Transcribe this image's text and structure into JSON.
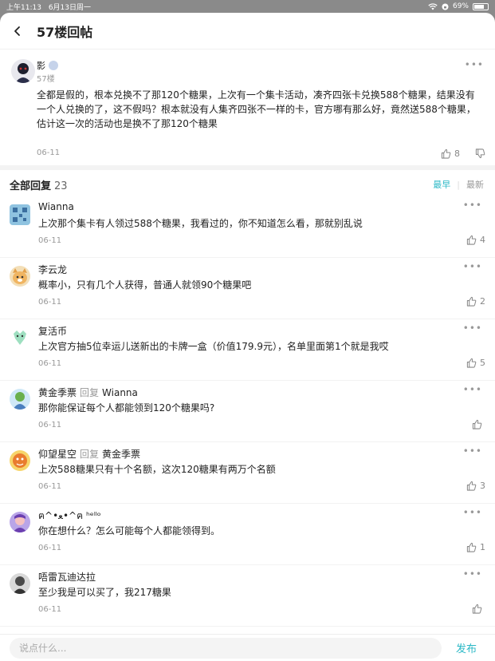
{
  "status_bar": {
    "time": "上午11:13",
    "date": "6月13日周一",
    "battery": "69%"
  },
  "nav": {
    "title": "57楼回帖"
  },
  "main_post": {
    "author": "影",
    "floor": "57楼",
    "content": "全都是假的，根本兑换不了那120个糖果，上次有一个集卡活动，凑齐四张卡兑换588个糖果，结果没有一个人兑换的了，这不假吗？根本就没有人集齐四张不一样的卡，官方哪有那么好，竟然送588个糖果，估计这一次的活动也是换不了那120个糖果",
    "date": "06-11",
    "likes": "8"
  },
  "replies_header": {
    "title": "全部回复",
    "count": "23",
    "sort_earliest": "最早",
    "sort_latest": "最新"
  },
  "replies": [
    {
      "author": "Wianna",
      "reply_label": "",
      "reply_to": "",
      "text": "上次那个集卡有人领过588个糖果，我看过的，你不知道怎么看，那就别乱说",
      "date": "06-11",
      "likes": "4"
    },
    {
      "author": "李云龙",
      "reply_label": "",
      "reply_to": "",
      "text": "概率小，只有几个人获得，普通人就领90个糖果吧",
      "date": "06-11",
      "likes": "2"
    },
    {
      "author": "复活币",
      "reply_label": "",
      "reply_to": "",
      "text": "上次官方抽5位幸运儿送新出的卡牌一盒（价值179.9元），名单里面第1个就是我哎",
      "date": "06-11",
      "likes": "5"
    },
    {
      "author": "黄金季票",
      "reply_label": "回复",
      "reply_to": "Wianna",
      "text": "那你能保证每个人都能领到120个糖果吗?",
      "date": "06-11",
      "likes": ""
    },
    {
      "author": "仰望星空",
      "reply_label": "回复",
      "reply_to": "黄金季票",
      "text": "上次588糖果只有十个名额，这次120糖果有两万个名额",
      "date": "06-11",
      "likes": "3"
    },
    {
      "author": "ฅ^•ﻌ•^ฅ ʰᵉˡˡᵒ",
      "reply_label": "",
      "reply_to": "",
      "text": "你在想什么？怎么可能每个人都能领得到。",
      "date": "06-11",
      "likes": "1"
    },
    {
      "author": "唔雷瓦迪达拉",
      "reply_label": "",
      "reply_to": "",
      "text": "至少我是可以买了，我217糖果",
      "date": "06-11",
      "likes": ""
    }
  ],
  "input": {
    "placeholder": "说点什么...",
    "send": "发布"
  },
  "colors": {
    "accent": "#2bb8c6"
  }
}
